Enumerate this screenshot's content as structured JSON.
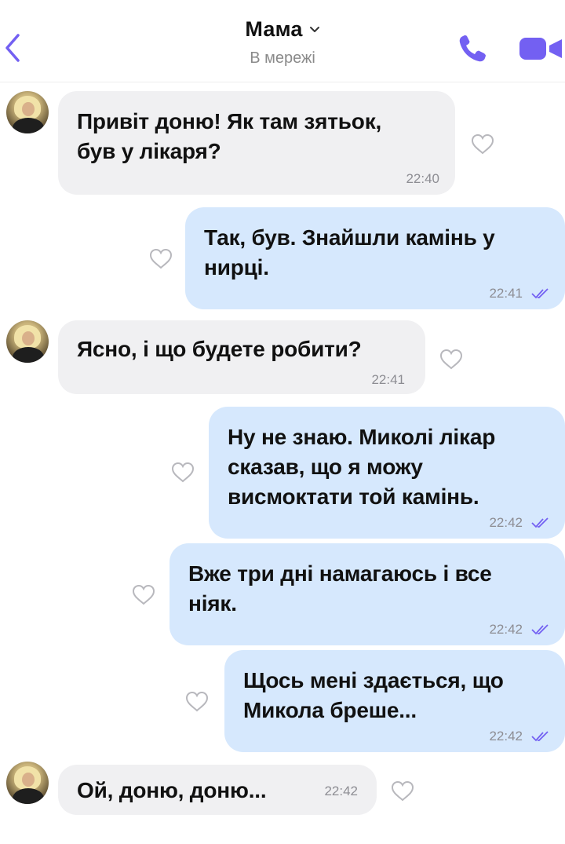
{
  "header": {
    "contact_name": "Мама",
    "status": "В мережі"
  },
  "colors": {
    "accent": "#7360f2",
    "incoming_bubble": "#f0f0f2",
    "outgoing_bubble": "#d6e8fd"
  },
  "messages": [
    {
      "direction": "in",
      "lines": [
        "Привіт доню! Як там зятьок,",
        "був у лікаря?"
      ],
      "time": "22:40"
    },
    {
      "direction": "out",
      "lines": [
        "Так, був. Знайшли камінь у",
        "нирці."
      ],
      "time": "22:41",
      "status_icon": "double-check-icon"
    },
    {
      "direction": "in",
      "lines": [
        "Ясно, і що будете робити?"
      ],
      "time": "22:41"
    },
    {
      "direction": "out",
      "lines": [
        "Ну не знаю. Миколі лікар",
        "сказав, що я можу",
        "висмоктати той камінь."
      ],
      "time": "22:42",
      "status_icon": "double-check-icon"
    },
    {
      "direction": "out",
      "lines": [
        "Вже три дні намагаюсь і все",
        "ніяк."
      ],
      "time": "22:42",
      "status_icon": "double-check-icon"
    },
    {
      "direction": "out",
      "lines": [
        "Щось мені здається, що",
        "Микола бреше..."
      ],
      "time": "22:42",
      "status_icon": "double-check-icon"
    },
    {
      "direction": "in",
      "lines": [
        "Ой, доню, доню..."
      ],
      "time": "22:42"
    }
  ]
}
